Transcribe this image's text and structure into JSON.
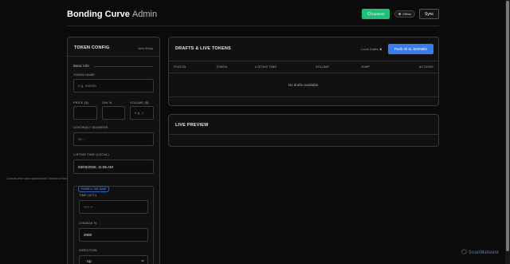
{
  "header": {
    "brand": "Bonding Curve",
    "brand_sub": "Admin",
    "connect_label": "Connect",
    "status_label": "Offline",
    "sync_label": "Sync"
  },
  "config": {
    "title": "TOKEN CONFIG",
    "new_entry": "New Entry",
    "basic_info": "Basic Info",
    "token_name_label": "TOKEN NAME",
    "token_name_placeholder": "e.g. Solana",
    "price_label": "PRICE ($)",
    "change24_label": "24H %",
    "volume_label": "VOLUME ($)",
    "volume_placeholder": "e.g. 1",
    "contract_label": "CONTRACT ADDRESS",
    "contract_placeholder": "0x...",
    "listing_time_label": "LISTING TIME (LOCAL)",
    "listing_time_value": "03/03/2026, 11:55 AM",
    "hint": "Controls when token appears/exits. Defaults to Now.",
    "phase_badge": "PHASE 1: THE JUMP",
    "time_utc_label": "TIME (UTC)",
    "time_utc_value": "--:-- --",
    "change_label": "CHANGE %",
    "change_value": "2000",
    "direction_label": "DIRECTION",
    "direction_value": "Up"
  },
  "drafts": {
    "title": "DRAFTS & LIVE TOKENS",
    "local_drafts_label": "Local Drafts:",
    "local_drafts_count": "0",
    "push_label": "Push All to JSONBin",
    "columns": [
      "STATUS",
      "TOKEN",
      "LISTING TIME",
      "VOLUME",
      "JUMP",
      "ACTIONS"
    ],
    "empty_text": "No drafts available."
  },
  "preview": {
    "title": "LIVE PREVIEW"
  },
  "watermark": "ScanMalware",
  "colors": {
    "connect": "#1fbf7a",
    "push": "#3a7de8",
    "phase_badge": "#5b9cff"
  }
}
